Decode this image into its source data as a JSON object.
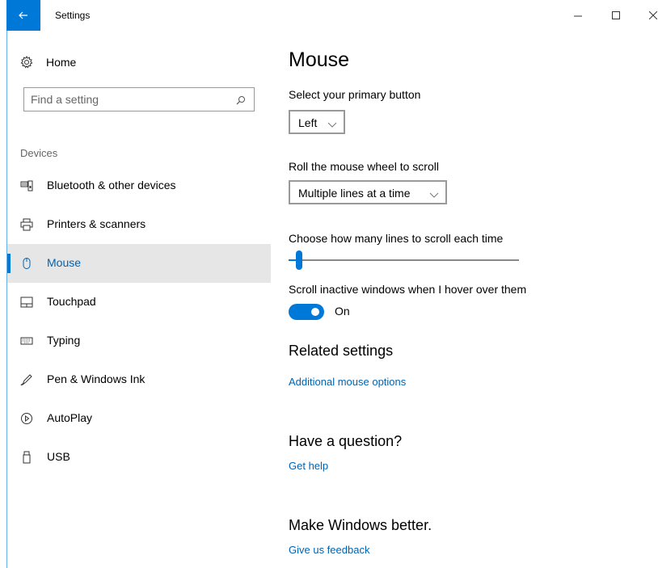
{
  "window": {
    "title": "Settings",
    "controls": {
      "minimize": "–",
      "maximize": "☐",
      "close": "✕"
    },
    "accent_color": "#0078d7"
  },
  "sidebar": {
    "home_label": "Home",
    "search": {
      "placeholder": "Find a setting"
    },
    "section_label": "Devices",
    "items": [
      {
        "label": "Bluetooth & other devices",
        "icon": "bluetooth-devices-icon",
        "selected": false
      },
      {
        "label": "Printers & scanners",
        "icon": "printer-icon",
        "selected": false
      },
      {
        "label": "Mouse",
        "icon": "mouse-icon",
        "selected": true
      },
      {
        "label": "Touchpad",
        "icon": "touchpad-icon",
        "selected": false
      },
      {
        "label": "Typing",
        "icon": "keyboard-icon",
        "selected": false
      },
      {
        "label": "Pen & Windows Ink",
        "icon": "pen-icon",
        "selected": false
      },
      {
        "label": "AutoPlay",
        "icon": "autoplay-icon",
        "selected": false
      },
      {
        "label": "USB",
        "icon": "usb-icon",
        "selected": false
      }
    ]
  },
  "main": {
    "title": "Mouse",
    "primary_button": {
      "label": "Select your primary button",
      "value": "Left"
    },
    "wheel_scroll": {
      "label": "Roll the mouse wheel to scroll",
      "value": "Multiple lines at a time"
    },
    "lines_scroll": {
      "label": "Choose how many lines to scroll each time",
      "slider_fraction": 0.03
    },
    "inactive_scroll": {
      "label": "Scroll inactive windows when I hover over them",
      "state": "On"
    },
    "related": {
      "heading": "Related settings",
      "link": "Additional mouse options"
    },
    "question": {
      "heading": "Have a question?",
      "link": "Get help"
    },
    "better": {
      "heading": "Make Windows better.",
      "link": "Give us feedback"
    }
  }
}
